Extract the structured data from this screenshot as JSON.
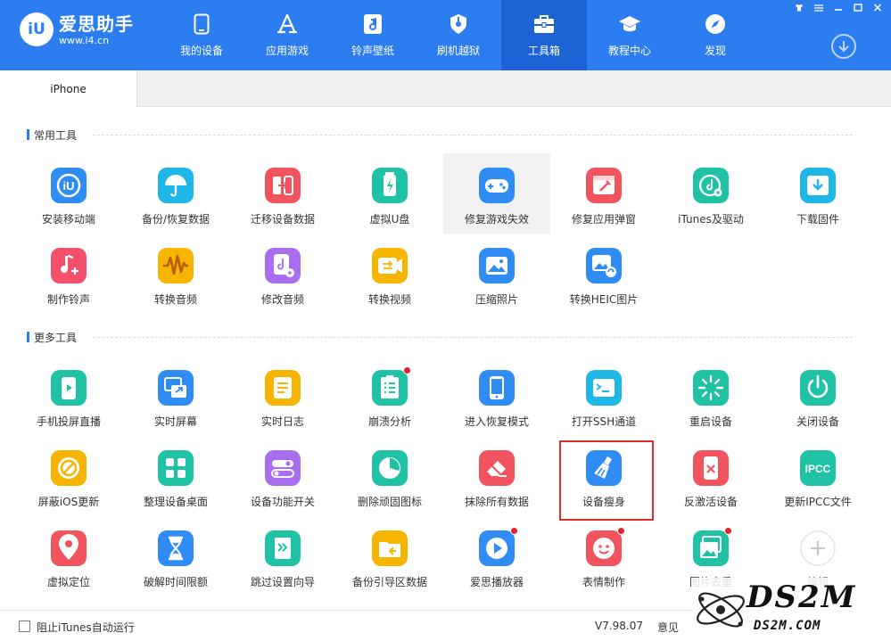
{
  "app": {
    "logo_mark": "iU",
    "name": "爱思助手",
    "url": "www.i4.cn"
  },
  "nav": [
    {
      "label": "我的设备",
      "icon": "phone-icon"
    },
    {
      "label": "应用游戏",
      "icon": "appstore-icon"
    },
    {
      "label": "铃声壁纸",
      "icon": "music-file-icon"
    },
    {
      "label": "刷机越狱",
      "icon": "flash-icon"
    },
    {
      "label": "工具箱",
      "icon": "toolbox-icon",
      "active": true
    },
    {
      "label": "教程中心",
      "icon": "graduation-cap-icon"
    },
    {
      "label": "发现",
      "icon": "compass-icon"
    }
  ],
  "window_controls": [
    "shirt-icon",
    "menu-icon",
    "minimize-icon",
    "maximize-icon",
    "close-icon"
  ],
  "device_tab": "iPhone",
  "sections": {
    "common": "常用工具",
    "more": "更多工具"
  },
  "common_tools": [
    {
      "label": "安装移动端",
      "icon": "iu-app-icon",
      "color": "#2f8cf5"
    },
    {
      "label": "备份/恢复数据",
      "icon": "umbrella-icon",
      "color": "#1fb7e8"
    },
    {
      "label": "迁移设备数据",
      "icon": "migrate-icon",
      "color": "#f1545f"
    },
    {
      "label": "虚拟U盘",
      "icon": "usb-drive-icon",
      "color": "#1fc3a3"
    },
    {
      "label": "修复游戏失效",
      "icon": "gamepad-icon",
      "color": "#2f8cf5",
      "hover": true
    },
    {
      "label": "修复应用弹窗",
      "icon": "repair-window-icon",
      "color": "#f1545f"
    },
    {
      "label": "iTunes及驱动",
      "icon": "itunes-gear-icon",
      "color": "#1fc3a3"
    },
    {
      "label": "下载固件",
      "icon": "download-box-icon",
      "color": "#1fb7e8"
    },
    {
      "label": "制作铃声",
      "icon": "music-note-plus-icon",
      "color": "#f4506c"
    },
    {
      "label": "转换音频",
      "icon": "waveform-icon",
      "color": "#f7b500"
    },
    {
      "label": "修改音频",
      "icon": "audio-edit-icon",
      "color": "#a86df0"
    },
    {
      "label": "转换视频",
      "icon": "video-convert-icon",
      "color": "#f7b500"
    },
    {
      "label": "压缩照片",
      "icon": "photo-icon",
      "color": "#2f8cf5"
    },
    {
      "label": "转换HEIC图片",
      "icon": "photo-convert-icon",
      "color": "#2f8cf5"
    }
  ],
  "more_tools": [
    {
      "label": "手机投屏直播",
      "icon": "screen-cast-icon",
      "color": "#1fc3a3"
    },
    {
      "label": "实时屏幕",
      "icon": "realtime-screen-icon",
      "color": "#2f8cf5"
    },
    {
      "label": "实时日志",
      "icon": "log-icon",
      "color": "#f7b500"
    },
    {
      "label": "崩溃分析",
      "icon": "crash-list-icon",
      "color": "#1fc3a3",
      "dot": true
    },
    {
      "label": "进入恢复模式",
      "icon": "recovery-phone-icon",
      "color": "#2f8cf5"
    },
    {
      "label": "打开SSH通道",
      "icon": "terminal-icon",
      "color": "#1fb7e8"
    },
    {
      "label": "重启设备",
      "icon": "restart-spark-icon",
      "color": "#1fc3a3"
    },
    {
      "label": "关闭设备",
      "icon": "power-icon",
      "color": "#1fc3a3"
    },
    {
      "label": "屏蔽iOS更新",
      "icon": "block-update-icon",
      "color": "#f7b500"
    },
    {
      "label": "整理设备桌面",
      "icon": "grid-icon",
      "color": "#1fc3a3"
    },
    {
      "label": "设备功能开关",
      "icon": "toggle-icon",
      "color": "#a86df0"
    },
    {
      "label": "删除顽固图标",
      "icon": "pie-clock-icon",
      "color": "#1fc3a3"
    },
    {
      "label": "抹除所有数据",
      "icon": "eraser-icon",
      "color": "#f1545f"
    },
    {
      "label": "设备瘦身",
      "icon": "broom-icon",
      "color": "#2f8cf5",
      "highlighted": true
    },
    {
      "label": "反激活设备",
      "icon": "deactivate-phone-icon",
      "color": "#f1545f"
    },
    {
      "label": "更新IPCC文件",
      "icon": "ipcc-icon",
      "color": "#1fc3a3"
    },
    {
      "label": "虚拟定位",
      "icon": "location-pin-icon",
      "color": "#f1545f"
    },
    {
      "label": "破解时间限额",
      "icon": "hourglass-icon",
      "color": "#2f8cf5"
    },
    {
      "label": "跳过设置向导",
      "icon": "skip-setup-icon",
      "color": "#1fc3a3"
    },
    {
      "label": "备份引导区数据",
      "icon": "backup-folder-icon",
      "color": "#f7b500"
    },
    {
      "label": "爱思播放器",
      "icon": "play-icon",
      "color": "#2f8cf5",
      "dot": true
    },
    {
      "label": "表情制作",
      "icon": "emoji-icon",
      "color": "#f1545f",
      "dot": true
    },
    {
      "label": "图片去重",
      "icon": "image-dedupe-icon",
      "color": "#1fc3a3",
      "dot": true
    },
    {
      "label": "编辑",
      "icon": "plus-icon",
      "color": "#ffffff",
      "add": true
    }
  ],
  "status": {
    "itunes_checkbox_label": "阻止iTunes自动运行",
    "version": "V7.98.07",
    "feedback": "意见"
  },
  "watermark": {
    "big": "DS2M",
    "small": "DS2M.COM"
  }
}
